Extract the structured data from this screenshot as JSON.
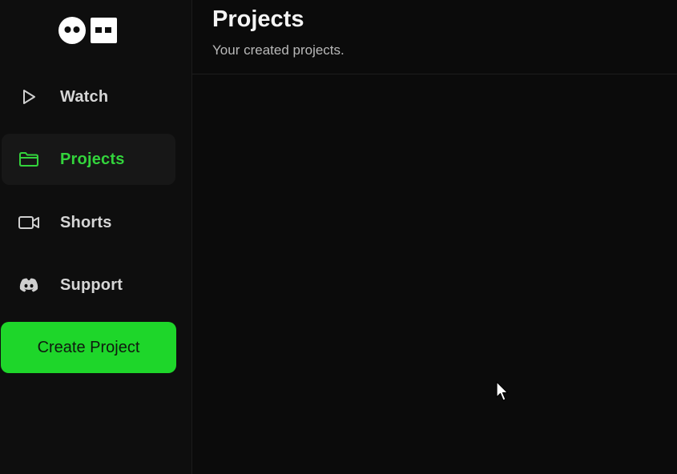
{
  "sidebar": {
    "items": [
      {
        "label": "Watch",
        "icon": "play-icon",
        "active": false
      },
      {
        "label": "Projects",
        "icon": "folder-icon",
        "active": true
      },
      {
        "label": "Shorts",
        "icon": "video-camera-icon",
        "active": false
      },
      {
        "label": "Support",
        "icon": "discord-icon",
        "active": false
      }
    ],
    "create_label": "Create Project"
  },
  "main": {
    "title": "Projects",
    "subtitle": "Your created projects."
  },
  "colors": {
    "accent": "#1ed62a",
    "active_text": "#33d43c",
    "background": "#0b0b0b"
  }
}
